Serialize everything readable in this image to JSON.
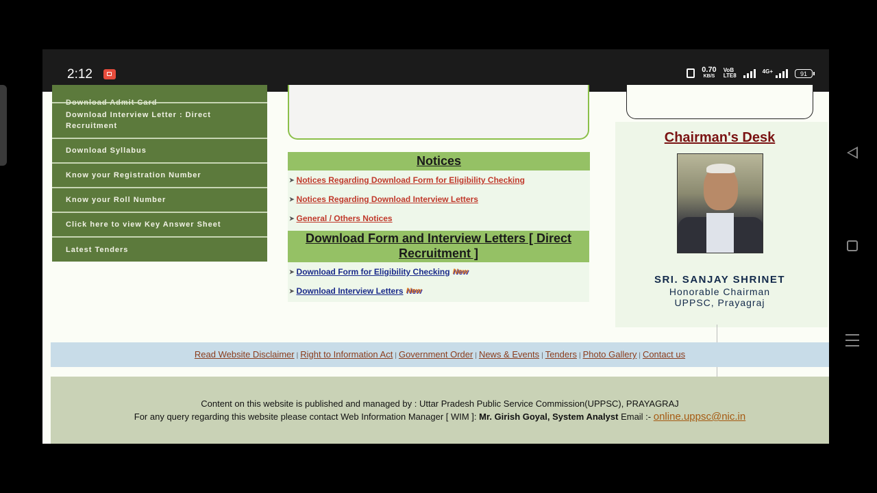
{
  "status": {
    "time": "2:12",
    "speed_value": "0.70",
    "speed_unit": "KB/S",
    "volte_top": "VoB",
    "volte_bottom": "LTE8",
    "network": "4G+",
    "battery": "91"
  },
  "menu": {
    "items": [
      {
        "label": "Download Admit Card"
      },
      {
        "label": "Download Interview Letter : Direct Recruitment"
      },
      {
        "label": "Download Syllabus"
      },
      {
        "label": "Know your Registration Number"
      },
      {
        "label": "Know your Roll Number"
      },
      {
        "label": "Click here to view Key Answer Sheet"
      },
      {
        "label": "Latest Tenders"
      }
    ]
  },
  "notices": {
    "title": "Notices",
    "links": [
      "Notices Regarding Download Form for Eligibility Checking",
      "Notices Regarding Download Interview Letters",
      "General / Others Notices"
    ]
  },
  "downloads": {
    "title": "Download Form and Interview Letters [ Direct Recruitment ]",
    "links": [
      "Download Form for Eligibility Checking",
      "Download Interview Letters"
    ],
    "badge": "New"
  },
  "chairman": {
    "title": "Chairman's Desk",
    "name": "SRI. SANJAY SHRINET",
    "role": "Honorable Chairman",
    "org": "UPPSC, Prayagraj"
  },
  "footer_links": [
    "Read Website Disclaimer",
    "Right to Information Act",
    "Government Order",
    "News & Events",
    "Tenders",
    "Photo Gallery",
    "Contact us"
  ],
  "footer": {
    "line1": "Content on this website is published and managed by : Uttar Pradesh Public Service Commission(UPPSC), PRAYAGRAJ",
    "line2_prefix": "For any query regarding this website please contact Web Information Manager [ WIM ]:",
    "line2_person": "Mr. Girish Goyal, System Analyst",
    "line2_email_label": "Email :-",
    "email": "online.uppsc@nic.in"
  },
  "colors": {
    "menu_bg": "#5c7a3c",
    "panel_head": "#95c165",
    "notice_link": "#c0392b",
    "download_link": "#1a2a8a",
    "chair_title": "#7a1212"
  }
}
